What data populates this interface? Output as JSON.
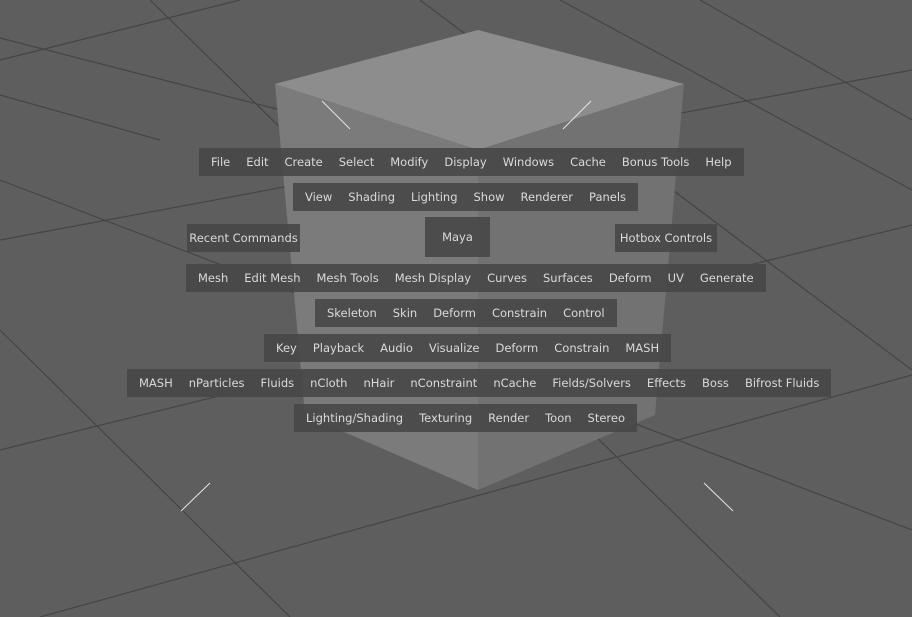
{
  "hotbox": {
    "main_menus": [
      "File",
      "Edit",
      "Create",
      "Select",
      "Modify",
      "Display",
      "Windows",
      "Cache",
      "Bonus Tools",
      "Help"
    ],
    "panel_menus": [
      "View",
      "Shading",
      "Lighting",
      "Show",
      "Renderer",
      "Panels"
    ],
    "recent_commands": "Recent Commands",
    "center_label": "Maya",
    "hotbox_controls": "Hotbox Controls",
    "modeling_menus": [
      "Mesh",
      "Edit Mesh",
      "Mesh Tools",
      "Mesh Display",
      "Curves",
      "Surfaces",
      "Deform",
      "UV",
      "Generate"
    ],
    "rigging_menus": [
      "Skeleton",
      "Skin",
      "Deform",
      "Constrain",
      "Control"
    ],
    "animation_menus": [
      "Key",
      "Playback",
      "Audio",
      "Visualize",
      "Deform",
      "Constrain",
      "MASH"
    ],
    "fx_menus": [
      "MASH",
      "nParticles",
      "Fluids",
      "nCloth",
      "nHair",
      "nConstraint",
      "nCache",
      "Fields/Solvers",
      "Effects",
      "Boss",
      "Bifrost Fluids"
    ],
    "rendering_menus": [
      "Lighting/Shading",
      "Texturing",
      "Render",
      "Toon",
      "Stereo"
    ]
  },
  "colors": {
    "viewport_bg": "#5e5e5e",
    "grid_line": "#444444",
    "cube_top": "#8e8e8e",
    "cube_left": "#7d7d7d",
    "cube_right": "#737373",
    "menu_bg": "#484848",
    "menu_text": "#dadada"
  }
}
